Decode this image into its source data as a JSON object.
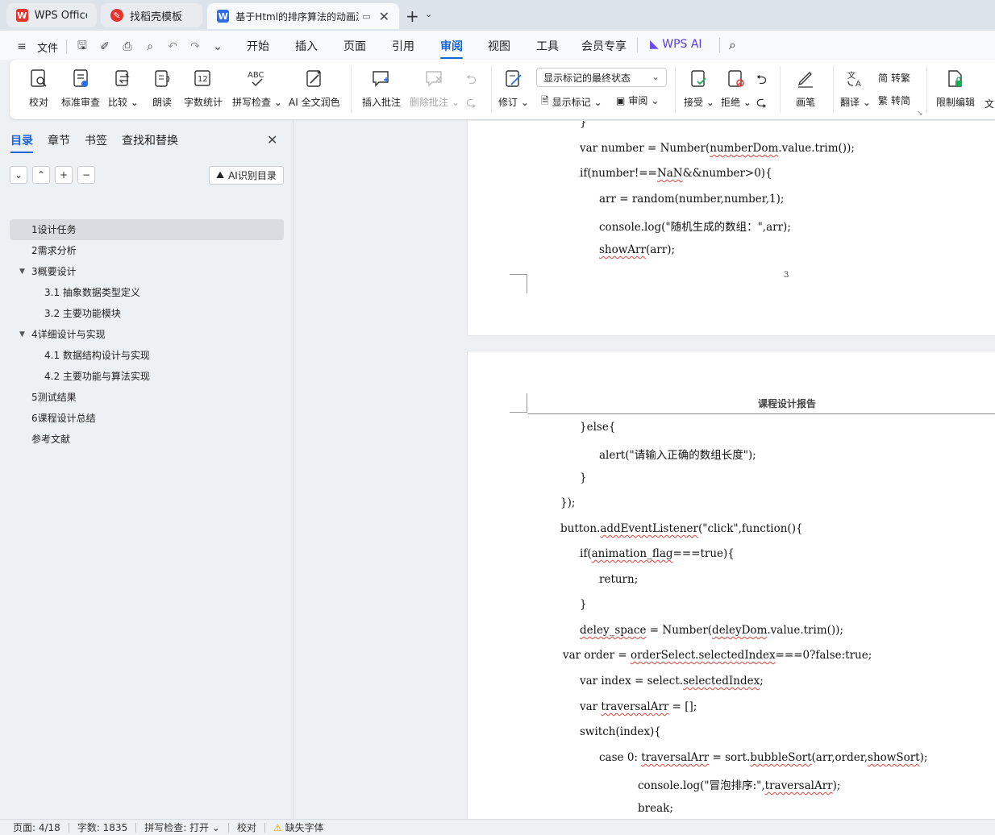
{
  "tabs": [
    {
      "label": "WPS Office",
      "logo": "W",
      "logo_color": "#e5342c"
    },
    {
      "label": "找稻壳模板",
      "logo": "稻",
      "logo_color": "#e5342c"
    },
    {
      "label": "基于Html的排序算法的动画演",
      "logo": "W",
      "logo_color": "#2a6ee8"
    }
  ],
  "menubar": {
    "file": "文件",
    "items": [
      "开始",
      "插入",
      "页面",
      "引用",
      "审阅",
      "视图",
      "工具",
      "会员专享",
      "WPS AI"
    ],
    "active": "审阅"
  },
  "ribbon": {
    "proofread": "校对",
    "standard_review": "标准审查",
    "compare": "比较",
    "read_aloud": "朗读",
    "word_count": "字数统计",
    "spell_check": "拼写检查",
    "ai_polish": "AI 全文润色",
    "insert_comment": "插入批注",
    "delete_comment": "删除批注",
    "track": "修订",
    "markup_dropdown": "显示标记的最终状态",
    "show_markup": "显示标记",
    "review_pane": "审阅",
    "accept": "接受",
    "reject": "拒绝",
    "pen": "画笔",
    "translate": "翻译",
    "to_traditional": "转繁",
    "to_simplified": "转简",
    "restrict_edit": "限制编辑",
    "more": "文"
  },
  "navpane": {
    "tabs": [
      "目录",
      "章节",
      "书签",
      "查找和替换"
    ],
    "ai_toc": "AI识别目录",
    "toc": [
      {
        "label": "1设计任务",
        "level": 1,
        "collapsible": false
      },
      {
        "label": "2需求分析",
        "level": 1,
        "collapsible": false
      },
      {
        "label": "3概要设计",
        "level": 1,
        "collapsible": true
      },
      {
        "label": "3.1 抽象数据类型定义",
        "level": 2,
        "collapsible": false
      },
      {
        "label": "3.2  主要功能模块",
        "level": 2,
        "collapsible": false
      },
      {
        "label": "4详细设计与实现",
        "level": 1,
        "collapsible": true
      },
      {
        "label": "4.1  数据结构设计与实现",
        "level": 2,
        "collapsible": false
      },
      {
        "label": "4.2  主要功能与算法实现",
        "level": 2,
        "collapsible": false
      },
      {
        "label": "5测试结果",
        "level": 1,
        "collapsible": false
      },
      {
        "label": "6课程设计总结",
        "level": 1,
        "collapsible": false
      },
      {
        "label": "参考文献",
        "level": 1,
        "collapsible": false
      }
    ]
  },
  "document": {
    "page_number": "3",
    "header_title": "课程设计报告",
    "page1_lines": [
      "}",
      "var number = Number(numberDom.value.trim());",
      "if(number!==NaN&&number>0){",
      "arr = random(number,number,1);",
      "console.log(\"随机生成的数组：\",arr);",
      "showArr(arr);"
    ],
    "page2_lines": [
      "}else{",
      "alert(\"请输入正确的数组长度\");",
      "}",
      "});",
      "button.addEventListener(\"click\",function(){",
      "if(animation_flag===true){",
      "return;",
      "}",
      "deley_space = Number(deleyDom.value.trim());",
      "var order = orderSelect.selectedIndex===0?false:true;",
      "var index = select.selectedIndex;",
      "var traversalArr = [];",
      "switch(index){",
      "case 0: traversalArr = sort.bubbleSort(arr,order,showSort);",
      "console.log(\"冒泡排序:\",traversalArr);",
      "break;"
    ]
  },
  "statusbar": {
    "page": "页面: 4/18",
    "words": "字数: 1835",
    "spell": "拼写检查: 打开",
    "proof": "校对",
    "missing_font": "缺失字体"
  }
}
